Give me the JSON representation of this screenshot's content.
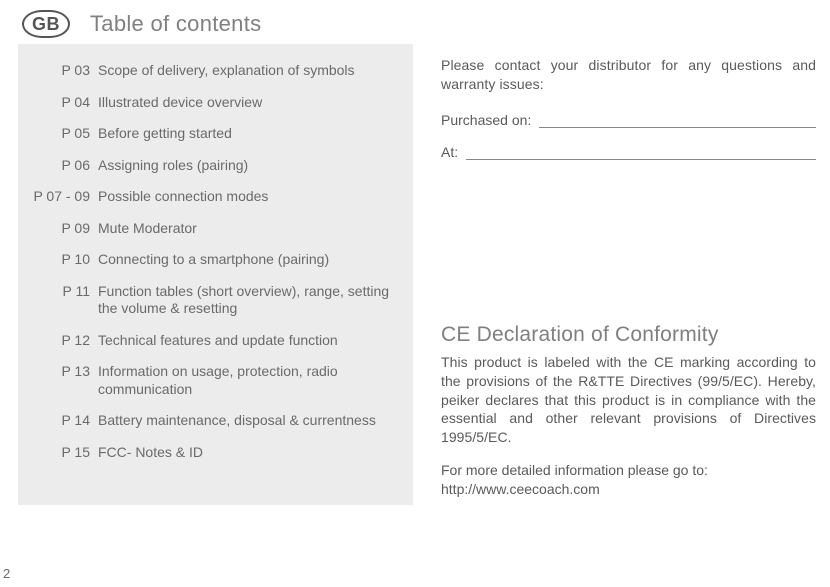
{
  "header": {
    "badge": "GB",
    "title": "Table of contents"
  },
  "toc": [
    {
      "page": "P 03",
      "title": "Scope of delivery, explanation of symbols"
    },
    {
      "page": "P 04",
      "title": "Illustrated device overview"
    },
    {
      "page": "P 05",
      "title": " Before getting started"
    },
    {
      "page": "P 06",
      "title": "Assigning roles (pairing)"
    },
    {
      "page": "P 07 - 09",
      "title": "Possible connection modes"
    },
    {
      "page": "P 09",
      "title": "Mute Moderator"
    },
    {
      "page": "P 10",
      "title": "Connecting to a smartphone (pairing)"
    },
    {
      "page": "P 11",
      "title": "Function tables (short overview), range, setting the volume & resetting"
    },
    {
      "page": "P 12",
      "title": "Technical features and update function"
    },
    {
      "page": "P 13",
      "title": " Information on usage, protection, radio communication"
    },
    {
      "page": "P 14",
      "title": "Battery maintenance, disposal & currentness"
    },
    {
      "page": "P 15",
      "title": "FCC- Notes & ID"
    }
  ],
  "right": {
    "contact": "Please contact your distributor for any questions and warranty issues:",
    "purchased_label": "Purchased on:",
    "at_label": "At:",
    "ce_heading": "CE Declaration of Conformity",
    "ce_body": "This product is labeled with the CE marking according to the provisions of the R&TTE Directives (99/5/EC). Hereby, peiker declares that this product is in compliance with the essential and other relevant provisions of Directives 1995/5/EC.",
    "ce_more_label": "For more detailed information please go to:",
    "ce_url": "http://www.ceecoach.com"
  },
  "page_number": "2"
}
